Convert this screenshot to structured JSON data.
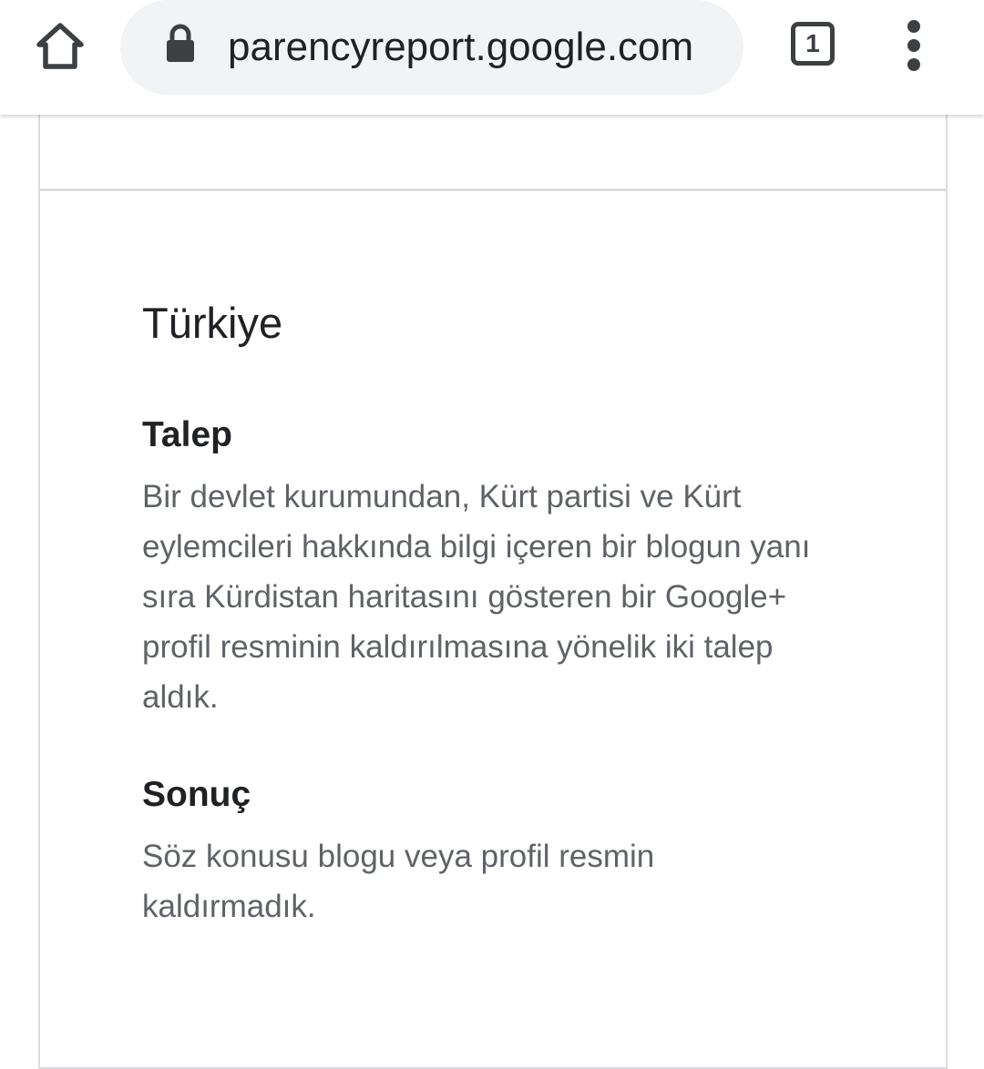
{
  "browser": {
    "url": "parencyreport.google.com",
    "tab_count": "1"
  },
  "content": {
    "country": "Türkiye",
    "request_heading": "Talep",
    "request_text": "Bir devlet kurumundan, Kürt partisi ve Kürt eylemcileri hakkında bilgi içeren bir blogun yanı sıra Kürdistan haritasını gösteren bir Google+ profil resminin kaldırılmasına yönelik iki talep aldık.",
    "outcome_heading": "Sonuç",
    "outcome_text": "Söz konusu blogu veya profil resmin kaldırmadık."
  },
  "colors": {
    "toolbar_bg": "#ffffff",
    "omnibox_bg": "#f1f3f4",
    "text_primary": "#202124",
    "text_secondary": "#5f6368",
    "border": "#dadce0"
  }
}
